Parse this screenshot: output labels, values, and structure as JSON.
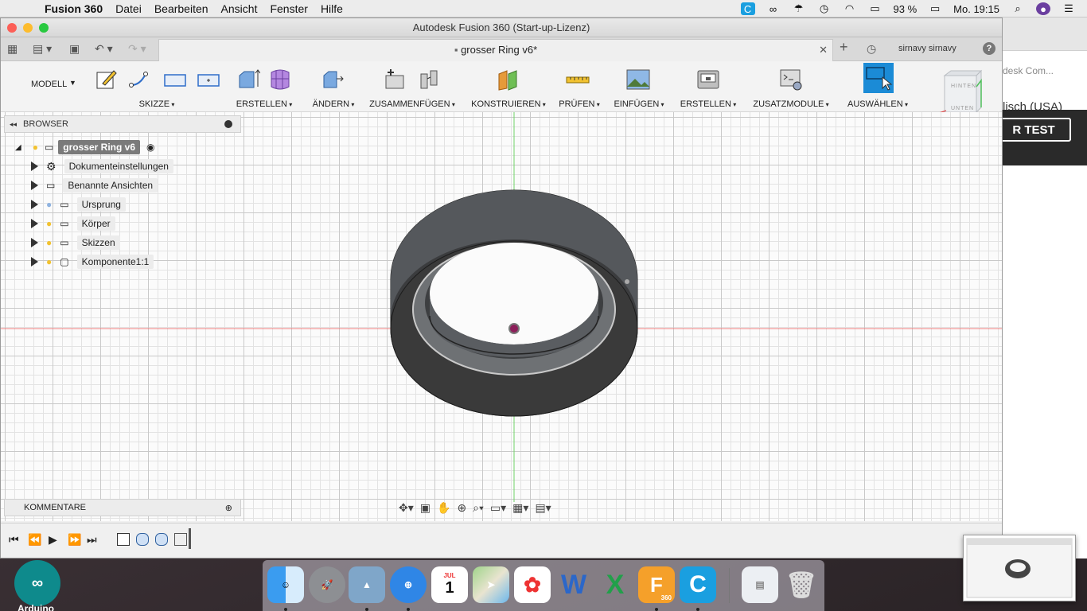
{
  "menubar": {
    "app": "Fusion 360",
    "items": [
      "Datei",
      "Bearbeiten",
      "Ansicht",
      "Fenster",
      "Hilfe"
    ],
    "battery": "93 %",
    "clock": "Mo. 19:15"
  },
  "window": {
    "title": "Autodesk Fusion 360 (Start-up-Lizenz)",
    "doc_tab": "grosser Ring v6*",
    "user": "sirnavy sirnavy",
    "help": "?"
  },
  "toolbar": {
    "workspace": "MODELL",
    "groups": [
      "SKIZZE",
      "ERSTELLEN",
      "ÄNDERN",
      "ZUSAMMENFÜGEN",
      "KONSTRUIEREN",
      "PRÜFEN",
      "EINFÜGEN",
      "ERSTELLEN",
      "ZUSATZMODULE",
      "AUSWÄHLEN"
    ]
  },
  "viewcube": {
    "top": "HINTEN",
    "bottom": "UNTEN"
  },
  "browser": {
    "title": "BROWSER",
    "root": "grosser Ring v6",
    "items": [
      "Dokumenteinstellungen",
      "Benannte Ansichten",
      "Ursprung",
      "Körper",
      "Skizzen",
      "Komponente1:1"
    ]
  },
  "comments": {
    "title": "KOMMENTARE"
  },
  "background_browser": {
    "tab": "desk Com...",
    "lang": "lisch (USA)",
    "button": "R TEST"
  },
  "dock": {
    "arduino_label": "Arduino",
    "fusion_badge": "360",
    "calendar_month": "JUL",
    "calendar_day": "1"
  },
  "colors": {
    "accent": "#1b8bd6",
    "ring_dark": "#3a3a3a",
    "ring_mid": "#6c6f73"
  }
}
